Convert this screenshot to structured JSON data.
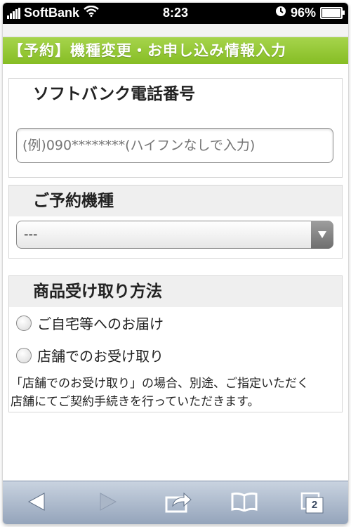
{
  "status_bar": {
    "carrier": "SoftBank",
    "time": "8:23",
    "battery": "96%",
    "battery_level": 0.96
  },
  "banner": {
    "title": "【予約】機種変更・お申し込み情報入力"
  },
  "phone_section": {
    "heading": "ソフトバンク電話番号",
    "placeholder": "(例)090********(ハイフンなしで入力)"
  },
  "model_section": {
    "heading": "ご予約機種",
    "selected": "---"
  },
  "pickup_section": {
    "heading": "商品受け取り方法",
    "options": [
      {
        "label": "ご自宅等へのお届け"
      },
      {
        "label": "店舗でのお受け取り"
      }
    ],
    "note_line1": "「店舗でのお受け取り」の場合、別途、ご指定いただく",
    "note_line2": "店舗にてご契約手続きを行っていただきます。"
  },
  "toolbar": {
    "tabs_count": "2"
  }
}
